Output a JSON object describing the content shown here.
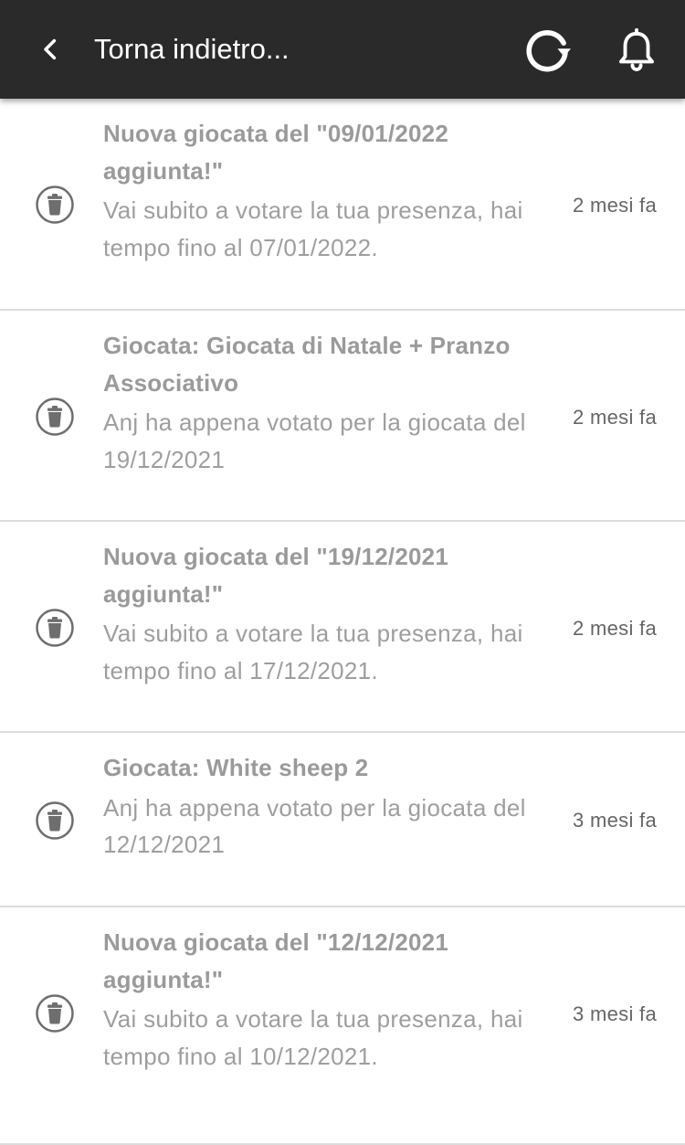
{
  "header": {
    "title": "Torna indietro...",
    "back_icon": "chevron-left-icon",
    "refresh_icon": "refresh-icon",
    "bell_icon": "bell-icon",
    "background_color": "#2a2a2a"
  },
  "notifications": [
    {
      "title": "Nuova giocata del \"09/01/2022 aggiunta!\"",
      "body": "Vai subito a votare la tua presenza, hai tempo fino al 07/01/2022.",
      "time": "2 mesi fa"
    },
    {
      "title": "Giocata: Giocata di Natale + Pranzo Associativo",
      "body": "Anj ha appena votato per la giocata del 19/12/2021",
      "time": "2 mesi fa"
    },
    {
      "title": "Nuova giocata del \"19/12/2021 aggiunta!\"",
      "body": "Vai subito a votare la tua presenza, hai tempo fino al 17/12/2021.",
      "time": "2 mesi fa"
    },
    {
      "title": "Giocata: White sheep 2",
      "body": "Anj ha appena votato per la giocata del 12/12/2021",
      "time": "3 mesi fa"
    },
    {
      "title": "Nuova giocata del \"12/12/2021 aggiunta!\"",
      "body": "Vai subito a votare la tua presenza, hai tempo fino al 10/12/2021.",
      "time": "3 mesi fa"
    }
  ],
  "item_icon": "trash-icon"
}
